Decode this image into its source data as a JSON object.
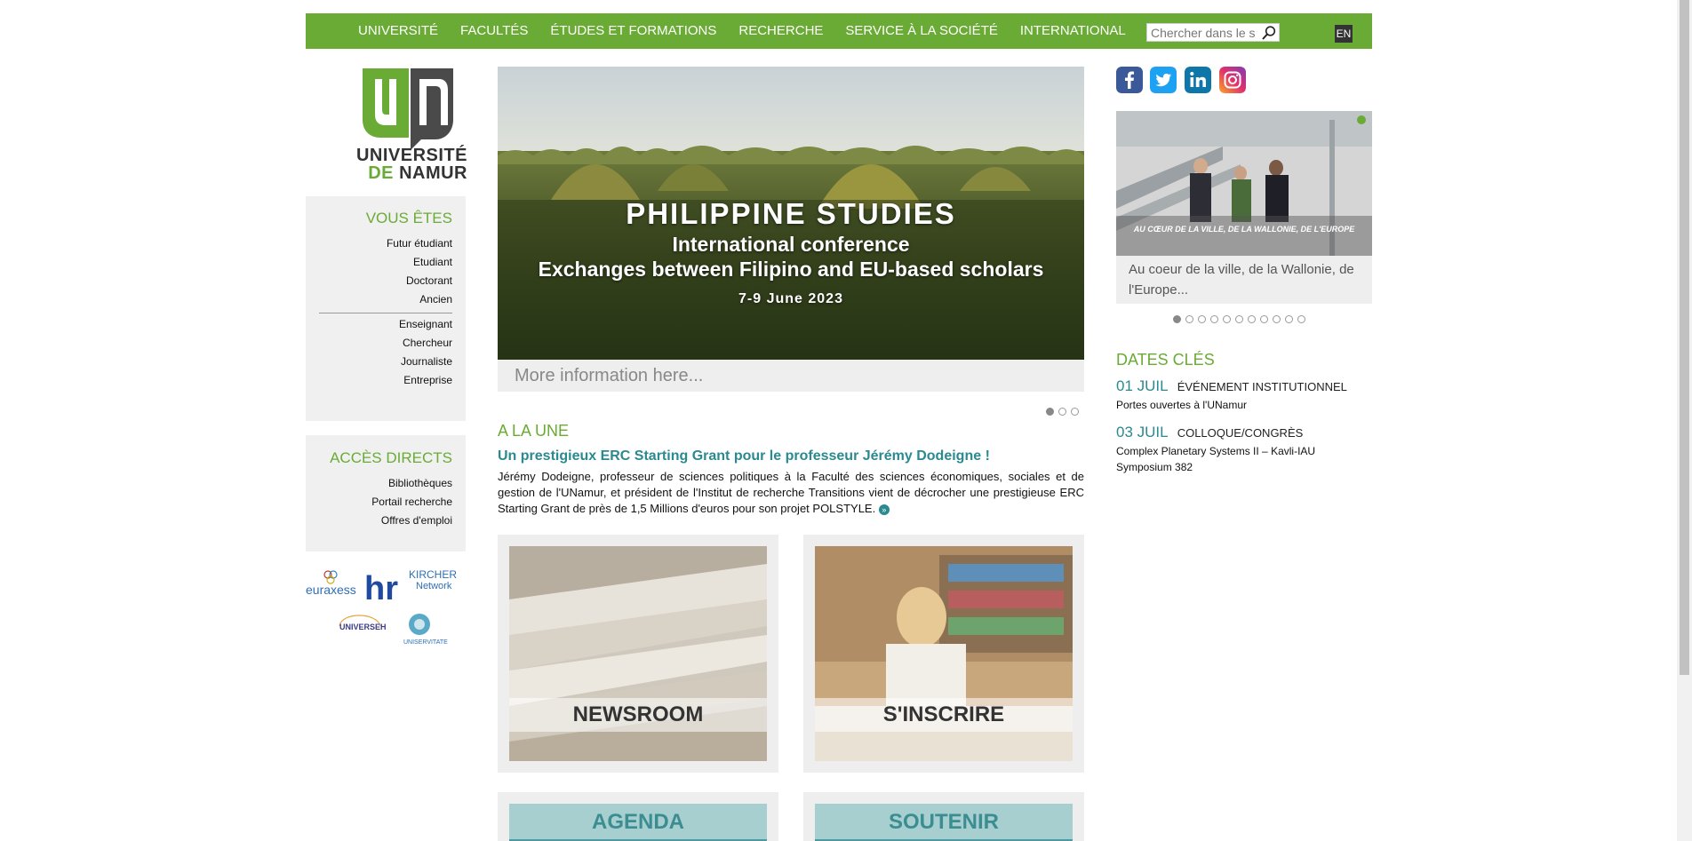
{
  "nav": {
    "items": [
      "UNIVERSITÉ",
      "FACULTÉS",
      "ÉTUDES ET FORMATIONS",
      "RECHERCHE",
      "SERVICE À LA SOCIÉTÉ",
      "INTERNATIONAL"
    ],
    "search_placeholder": "Chercher dans le site",
    "lang": "EN"
  },
  "logo": {
    "line1": "UNIVERSITÉ",
    "line2a": "DE",
    "line2b": "NAMUR"
  },
  "vous_etes": {
    "title": "VOUS ÊTES",
    "group1": [
      "Futur étudiant",
      "Etudiant",
      "Doctorant",
      "Ancien"
    ],
    "group2": [
      "Enseignant",
      "Chercheur",
      "Journaliste",
      "Entreprise"
    ]
  },
  "acces_directs": {
    "title": "ACCÈS DIRECTS",
    "links": [
      "Bibliothèques",
      "Portail recherche",
      "Offres d'emploi"
    ]
  },
  "partners": {
    "euraxess": "euraxess",
    "hr": "hr",
    "kircher": "KIRCHER",
    "kircher_sub": "Network",
    "universeh": "UNIVERSEH",
    "unisevitate": "UNISERVITATE"
  },
  "banner": {
    "title": "PHILIPPINE STUDIES",
    "line1": "International conference",
    "line2": "Exchanges between Filipino and EU-based scholars",
    "date": "7-9 June 2023",
    "caption": "More information here...",
    "dot_count": 3,
    "active_dot": 0
  },
  "a_la_une": {
    "title": "A LA UNE",
    "headline": "Un prestigieux ERC Starting Grant pour le professeur Jérémy Dodeigne !",
    "body": "Jérémy Dodeigne, professeur de sciences politiques à la Faculté des sciences économiques, sociales et de gestion de l'UNamur, et président de l'Institut de recherche Transitions vient de décrocher une prestigieuse ERC Starting Grant de près de 1,5 Millions d'euros pour son projet POLSTYLE.",
    "more": "»"
  },
  "tiles": {
    "newsroom": "NEWSROOM",
    "inscrire": "S'INSCRIRE",
    "agenda": "AGENDA",
    "soutenir": "SOUTENIR"
  },
  "social": [
    "facebook",
    "twitter",
    "linkedin",
    "instagram"
  ],
  "video": {
    "overlay": "AU CŒUR DE LA VILLE, DE LA WALLONIE, DE L'EUROPE",
    "caption": "Au coeur de la ville, de la Wallonie, de l'Europe...",
    "dot_count": 11,
    "active_dot": 0
  },
  "dates_cles": {
    "title": "DATES CLÉS",
    "events": [
      {
        "date": "01 JUIL",
        "category": "ÉVÉNEMENT INSTITUTIONNEL",
        "title": "Portes ouvertes à l'UNamur"
      },
      {
        "date": "03 JUIL",
        "category": "COLLOQUE/CONGRÈS",
        "title": "Complex Planetary Systems II – Kavli-IAU Symposium 382"
      }
    ]
  },
  "colors": {
    "green": "#6aab35",
    "teal": "#2a8a8f",
    "panel": "#f0f0f0"
  }
}
